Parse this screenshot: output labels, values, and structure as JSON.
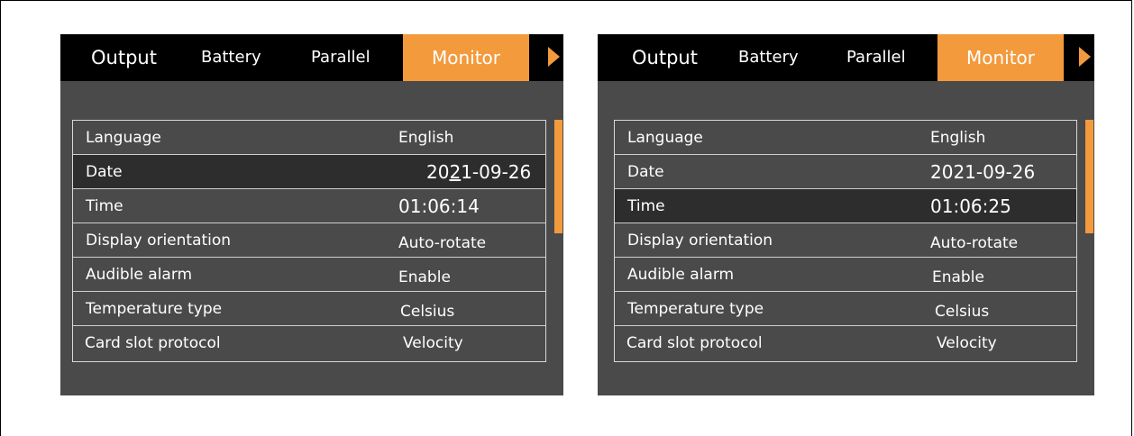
{
  "colors": {
    "accent": "#f39a3c",
    "panel_bg": "#4a4a4a",
    "tab_bg": "#000000",
    "selected_row": "#2d2d2d"
  },
  "screens": [
    {
      "tabs": [
        "Output",
        "Battery",
        "Parallel",
        "Monitor"
      ],
      "active_tab": "Monitor",
      "more_icon": "right-arrow-icon",
      "rows": [
        {
          "label": "Language",
          "value": "English"
        },
        {
          "label": "Date",
          "value_prefix": "20",
          "value_cursor": "2",
          "value_suffix": "1-09-26"
        },
        {
          "label": "Time",
          "value": "01:06:14"
        },
        {
          "label": "Display orientation",
          "value": "Auto-rotate"
        },
        {
          "label": "Audible alarm",
          "value": "Enable"
        },
        {
          "label": "Temperature type",
          "value": "Celsius"
        },
        {
          "label": "Card slot protocol",
          "value": "Velocity"
        }
      ],
      "selected_row": "Date"
    },
    {
      "tabs": [
        "Output",
        "Battery",
        "Parallel",
        "Monitor"
      ],
      "active_tab": "Monitor",
      "more_icon": "right-arrow-icon",
      "rows": [
        {
          "label": "Language",
          "value": "English"
        },
        {
          "label": "Date",
          "value": "2021-09-26"
        },
        {
          "label": "Time",
          "value": "01:06:25"
        },
        {
          "label": "Display orientation",
          "value": "Auto-rotate"
        },
        {
          "label": "Audible alarm",
          "value": "Enable"
        },
        {
          "label": "Temperature type",
          "value": "Celsius"
        },
        {
          "label": "Card slot protocol",
          "value": "Velocity"
        }
      ],
      "selected_row": "Time"
    }
  ]
}
